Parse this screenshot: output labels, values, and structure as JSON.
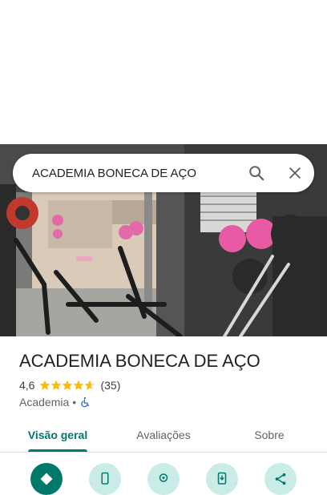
{
  "search": {
    "query": "ACADEMIA BONECA DE AÇO"
  },
  "place": {
    "name": "ACADEMIA BONECA DE AÇO",
    "rating": "4,6",
    "stars": 4.6,
    "review_count": "(35)",
    "category": "Academia",
    "separator": "•"
  },
  "tabs": [
    {
      "label": "Visão geral",
      "active": true
    },
    {
      "label": "Avaliações",
      "active": false
    },
    {
      "label": "Sobre",
      "active": false
    }
  ],
  "actions": [
    {
      "icon": "directions-icon"
    },
    {
      "icon": "phone-icon"
    },
    {
      "icon": "nearby-icon"
    },
    {
      "icon": "save-to-phone-icon"
    },
    {
      "icon": "share-icon"
    }
  ],
  "colors": {
    "accent": "#00796b",
    "star": "#fbbc04",
    "accessible": "#1a73e8"
  }
}
